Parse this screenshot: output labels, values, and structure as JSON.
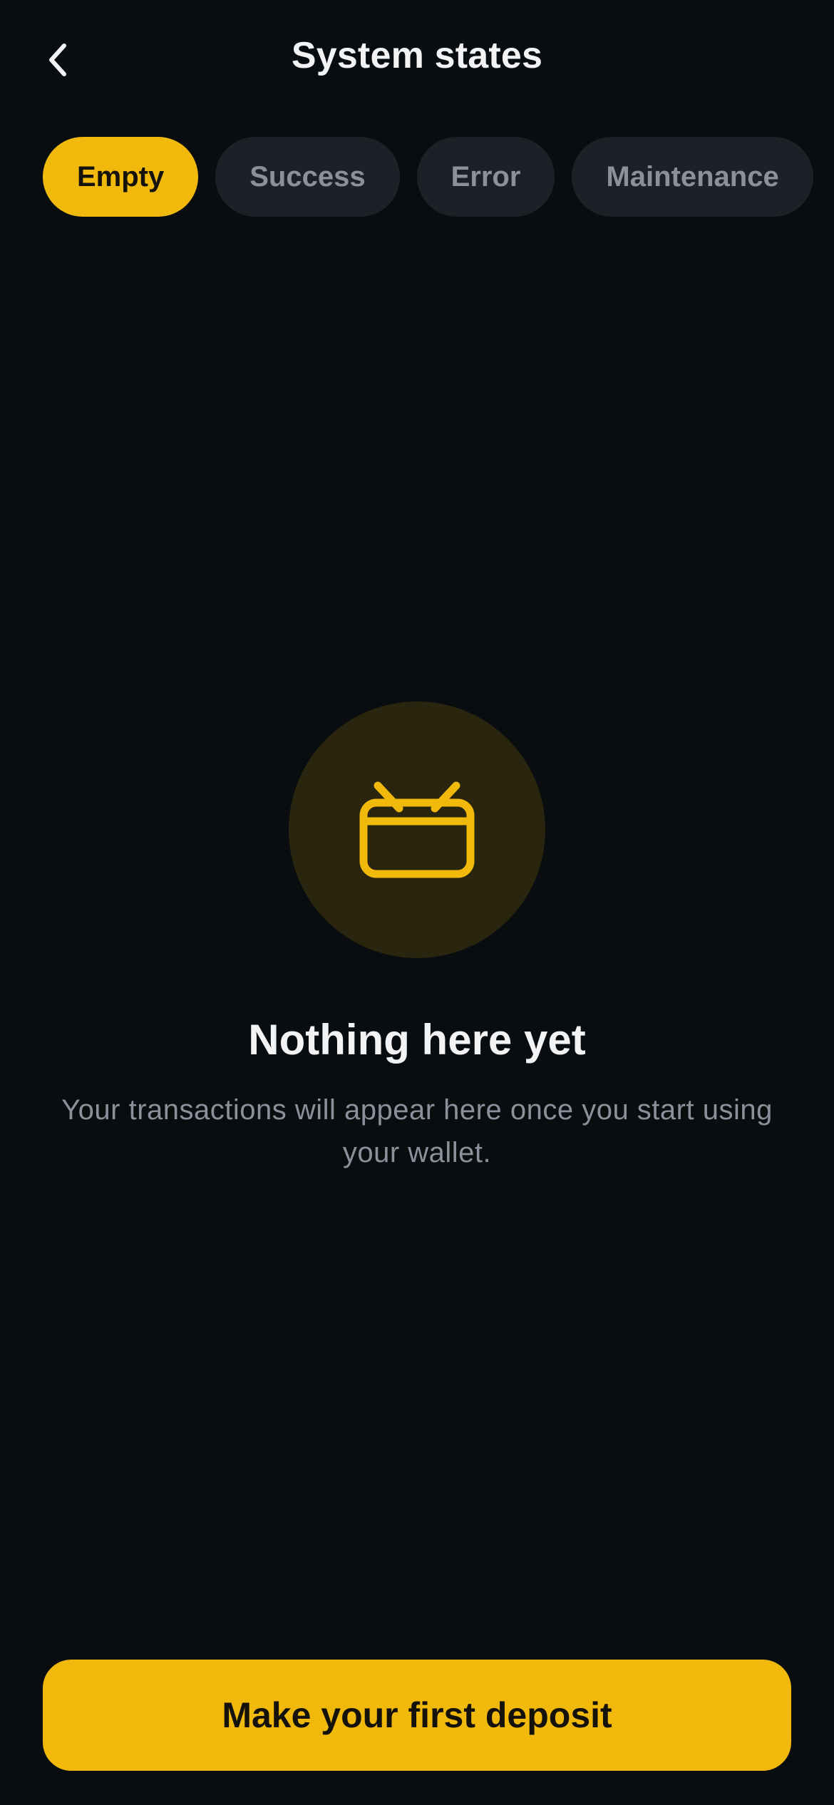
{
  "header": {
    "title": "System states"
  },
  "tabs": [
    {
      "label": "Empty",
      "active": true
    },
    {
      "label": "Success",
      "active": false
    },
    {
      "label": "Error",
      "active": false
    },
    {
      "label": "Maintenance",
      "active": false
    }
  ],
  "empty_state": {
    "icon": "wallet-icon",
    "title": "Nothing here yet",
    "description": "Your transactions will appear here once you start using your wallet."
  },
  "cta": {
    "label": "Make your first deposit"
  },
  "colors": {
    "background": "#0a0d10",
    "accent": "#f2b90d",
    "tab_inactive_bg": "#1d2127",
    "muted_text": "#8b919b",
    "icon_circle_bg": "#29250f"
  }
}
